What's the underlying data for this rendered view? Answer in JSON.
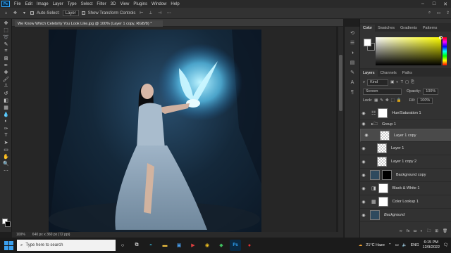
{
  "app": {
    "menu": [
      "File",
      "Edit",
      "Image",
      "Layer",
      "Type",
      "Select",
      "Filter",
      "3D",
      "View",
      "Plugins",
      "Window",
      "Help"
    ],
    "logo": "Ps"
  },
  "options": {
    "auto_select_label": "Auto-Select:",
    "auto_select_value": "Layer",
    "show_transform_label": "Show Transform Controls"
  },
  "document": {
    "tab_title": "We Know Which Celebrity You Look Like.jpg @ 100% (Layer 1 copy, RGB/8) *",
    "zoom": "100%",
    "size": "640 px x 360 px (72 ppi)"
  },
  "color_panel": {
    "tabs": [
      "Color",
      "Swatches",
      "Gradients",
      "Patterns"
    ],
    "active_tab": "Color",
    "fg": "#ffffff",
    "bg": "#222222"
  },
  "layers_panel": {
    "tabs": [
      "Layers",
      "Channels",
      "Paths"
    ],
    "active_tab": "Layers",
    "filter_label": "Kind",
    "blend_mode": "Screen",
    "opacity_label": "Opacity:",
    "opacity_value": "100%",
    "lock_label": "Lock:",
    "fill_label": "Fill:",
    "fill_value": "100%",
    "layers": [
      {
        "name": "Hue/Saturation 1",
        "type": "adjust"
      },
      {
        "name": "Group 1",
        "type": "group"
      },
      {
        "name": "Layer 1 copy",
        "type": "pixel",
        "selected": true
      },
      {
        "name": "Layer 1",
        "type": "pixel"
      },
      {
        "name": "Layer 1 copy 2",
        "type": "pixel"
      },
      {
        "name": "Background copy",
        "type": "photo-mask"
      },
      {
        "name": "Black & White 1",
        "type": "adjust"
      },
      {
        "name": "Color Lookup 1",
        "type": "adjust"
      },
      {
        "name": "Background",
        "type": "photo"
      }
    ]
  },
  "taskbar": {
    "search_placeholder": "Type here to search",
    "weather": "21°C Haze",
    "lang": "ENG",
    "time": "6:15 PM",
    "date": "12/9/2022"
  },
  "colors": {
    "accent": "#31a8ff",
    "panel": "#323232"
  }
}
